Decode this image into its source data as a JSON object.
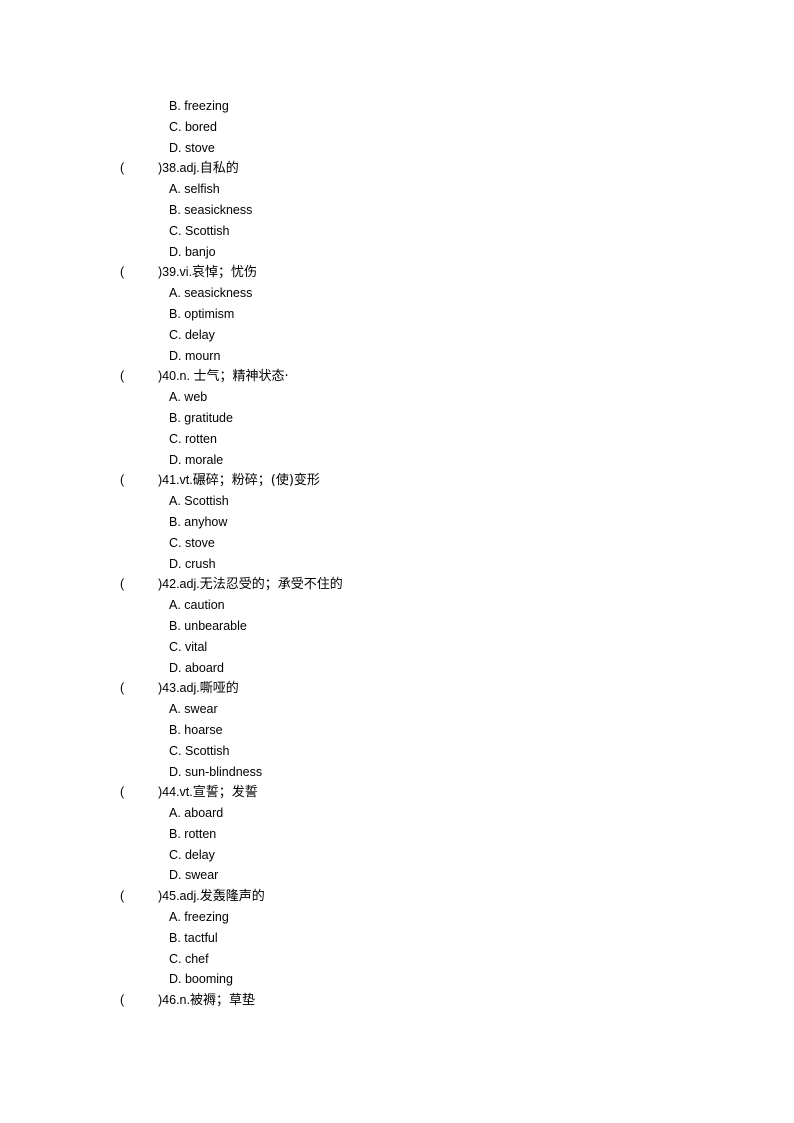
{
  "document": {
    "continued_options": [
      {
        "letter": "B.",
        "text": "freezing"
      },
      {
        "letter": "C.",
        "text": "bored"
      },
      {
        "letter": "D.",
        "text": "stove"
      }
    ],
    "questions": [
      {
        "paren_open": "(",
        "number_prefix": ")38.adj.",
        "definition": "自私的",
        "options": [
          {
            "letter": "A.",
            "text": "selfish"
          },
          {
            "letter": "B.",
            "text": "seasickness"
          },
          {
            "letter": "C.",
            "text": "Scottish"
          },
          {
            "letter": "D.",
            "text": "banjo"
          }
        ]
      },
      {
        "paren_open": "(",
        "number_prefix": ")39.vi.",
        "definition": "哀悼；忧伤",
        "options": [
          {
            "letter": "A.",
            "text": "seasickness"
          },
          {
            "letter": "B.",
            "text": "optimism"
          },
          {
            "letter": "C.",
            "text": "delay"
          },
          {
            "letter": "D.",
            "text": "mourn"
          }
        ]
      },
      {
        "paren_open": "(",
        "number_prefix": ")40.n. ",
        "definition": "士气；精神状态·",
        "options": [
          {
            "letter": "A.",
            "text": "web"
          },
          {
            "letter": "B.",
            "text": "gratitude"
          },
          {
            "letter": "C.",
            "text": "rotten"
          },
          {
            "letter": "D.",
            "text": "morale"
          }
        ]
      },
      {
        "paren_open": "(",
        "number_prefix": ")41.vt.",
        "definition": "碾碎；粉碎；(使)变形",
        "options": [
          {
            "letter": "A.",
            "text": "Scottish"
          },
          {
            "letter": "B.",
            "text": "anyhow"
          },
          {
            "letter": "C.",
            "text": "stove"
          },
          {
            "letter": "D.",
            "text": "crush"
          }
        ]
      },
      {
        "paren_open": "(",
        "number_prefix": ")42.adj.",
        "definition": "无法忍受的；承受不住的",
        "options": [
          {
            "letter": "A.",
            "text": "caution"
          },
          {
            "letter": "B.",
            "text": "unbearable"
          },
          {
            "letter": "C.",
            "text": "vital"
          },
          {
            "letter": "D.",
            "text": "aboard"
          }
        ]
      },
      {
        "paren_open": "(",
        "number_prefix": ")43.adj.",
        "definition": "嘶哑的",
        "options": [
          {
            "letter": "A.",
            "text": "swear"
          },
          {
            "letter": "B.",
            "text": "hoarse"
          },
          {
            "letter": "C.",
            "text": "Scottish"
          },
          {
            "letter": "D.",
            "text": "sun-blindness"
          }
        ]
      },
      {
        "paren_open": "(",
        "number_prefix": ")44.vt.",
        "definition": "宣誓；发誓",
        "options": [
          {
            "letter": "A.",
            "text": "aboard"
          },
          {
            "letter": "B.",
            "text": "rotten"
          },
          {
            "letter": "C.",
            "text": "delay"
          },
          {
            "letter": "D.",
            "text": "swear"
          }
        ]
      },
      {
        "paren_open": "(",
        "number_prefix": ")45.adj.",
        "definition": "发轰隆声的",
        "options": [
          {
            "letter": "A.",
            "text": "freezing"
          },
          {
            "letter": "B.",
            "text": "tactful"
          },
          {
            "letter": "C.",
            "text": "chef"
          },
          {
            "letter": "D.",
            "text": "booming"
          }
        ]
      },
      {
        "paren_open": "(",
        "number_prefix": ")46.n.",
        "definition": "被褥；草垫",
        "options": []
      }
    ]
  }
}
